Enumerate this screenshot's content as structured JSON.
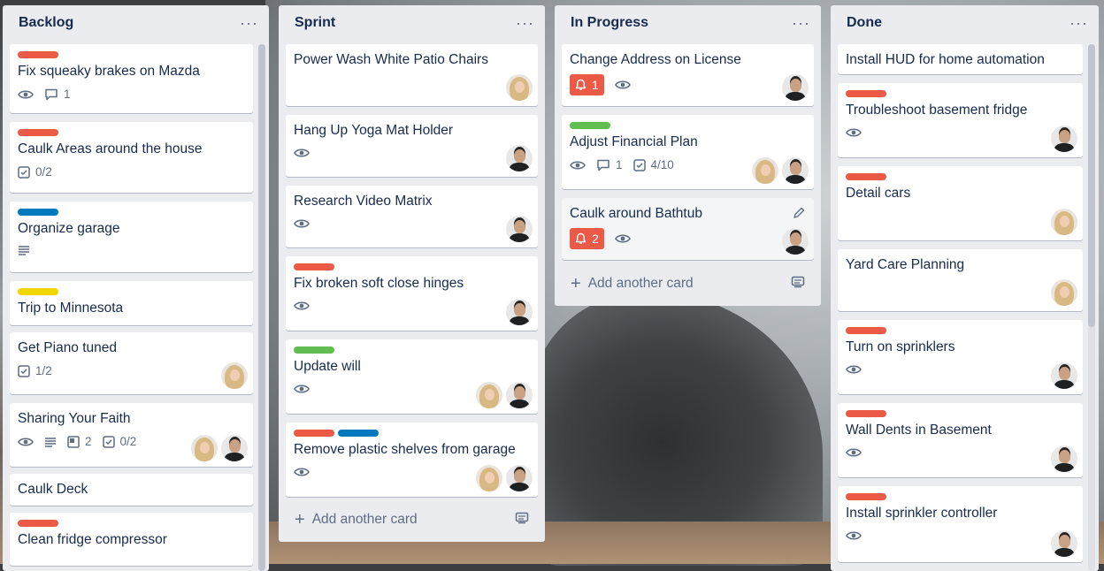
{
  "colors": {
    "red": "#eb5a46",
    "blue": "#0079bf",
    "green": "#61bd4f",
    "yellow": "#f2d600"
  },
  "columns": [
    {
      "title": "Backlog",
      "cards": [
        {
          "title": "Fix squeaky brakes on Mazda",
          "comments": "1"
        },
        {
          "title": "Caulk Areas around the house",
          "checklist": "0/2"
        },
        {
          "title": "Organize garage"
        },
        {
          "title": "Trip to Minnesota"
        },
        {
          "title": "Get Piano tuned",
          "checklist": "1/2"
        },
        {
          "title": "Sharing Your Faith",
          "attachments": "2",
          "checklist": "0/2"
        },
        {
          "title": "Caulk Deck"
        },
        {
          "title": "Clean fridge compressor"
        }
      ]
    },
    {
      "title": "Sprint",
      "cards": [
        {
          "title": "Power Wash White Patio Chairs"
        },
        {
          "title": "Hang Up Yoga Mat Holder"
        },
        {
          "title": "Research Video Matrix"
        },
        {
          "title": "Fix broken soft close hinges"
        },
        {
          "title": "Update will"
        },
        {
          "title": "Remove plastic shelves from garage"
        }
      ],
      "add_card": "Add another card"
    },
    {
      "title": "In Progress",
      "cards": [
        {
          "title": "Change Address on License",
          "notifications": "1"
        },
        {
          "title": "Adjust Financial Plan",
          "comments": "1",
          "checklist": "4/10"
        },
        {
          "title": "Caulk around Bathtub",
          "notifications": "2"
        }
      ],
      "add_card": "Add another card"
    },
    {
      "title": "Done",
      "cards": [
        {
          "title": "Install HUD for home automation"
        },
        {
          "title": "Troubleshoot basement fridge"
        },
        {
          "title": "Detail cars"
        },
        {
          "title": "Yard Care Planning"
        },
        {
          "title": "Turn on sprinklers"
        },
        {
          "title": "Wall Dents in Basement"
        },
        {
          "title": "Install sprinkler controller"
        }
      ]
    }
  ],
  "menu_icon": "more-horizontal-icon"
}
